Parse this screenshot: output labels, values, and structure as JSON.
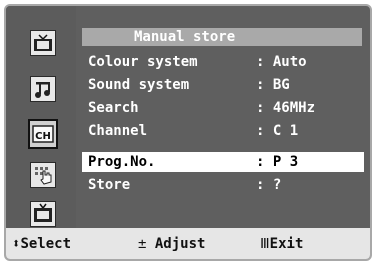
{
  "menu": {
    "title": "Manual store",
    "rows": [
      {
        "label": "Colour system",
        "value": ": Auto"
      },
      {
        "label": "Sound system",
        "value": ": BG"
      },
      {
        "label": "Search",
        "value": ": 46MHz"
      },
      {
        "label": "Channel",
        "value": ": C 1"
      },
      {
        "label": "Prog.No.",
        "value": ": P 3"
      },
      {
        "label": "Store",
        "value": ": ?"
      }
    ]
  },
  "sidebar": {
    "icons": [
      {
        "name": "picture-icon"
      },
      {
        "name": "sound-icon"
      },
      {
        "name": "channel-icon",
        "label": "CH"
      },
      {
        "name": "setup-icon"
      },
      {
        "name": "input-icon"
      }
    ]
  },
  "footer": {
    "select_symbol": "⬍",
    "select_label": "Select",
    "adjust_symbol": "±",
    "adjust_label": "Adjust",
    "exit_symbol": "Ⅲ",
    "exit_label": "Exit"
  }
}
